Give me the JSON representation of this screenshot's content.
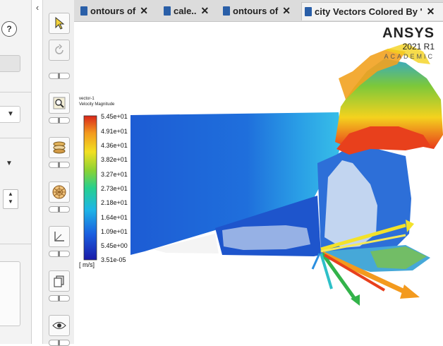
{
  "left_panel": {
    "collapse_glyph": "‹",
    "help_glyph": "?"
  },
  "toolbar": {
    "buttons": [
      "pointer-icon",
      "rotate-icon",
      "zoom-icon",
      "layers-icon",
      "mesh-sphere-icon",
      "axes-icon",
      "copy-icon",
      "eye-icon"
    ]
  },
  "tabs": [
    {
      "label": "ontours of",
      "active": false
    },
    {
      "label": "cale..",
      "active": false
    },
    {
      "label": "ontours of",
      "active": false
    },
    {
      "label": "city Vectors Colored By '",
      "active": true
    }
  ],
  "tab_close_glyph": "✕",
  "branding": {
    "name": "ANSYS",
    "version": "2021 R1",
    "edition": "ACADEMIC"
  },
  "legend": {
    "title_line1": "vector-1",
    "title_line2": "Velocity Magnitude",
    "ticks": [
      "5.45e+01",
      "4.91e+01",
      "4.36e+01",
      "3.82e+01",
      "3.27e+01",
      "2.73e+01",
      "2.18e+01",
      "1.64e+01",
      "1.09e+01",
      "5.45e+00",
      "3.51e-05"
    ],
    "units": "[ m/s]"
  },
  "colors": {
    "field_blue": "#1f5fd8",
    "field_light": "#35a8e8",
    "jet_red": "#e83a1a",
    "jet_yellow": "#f4d21e",
    "jet_green": "#33b34a",
    "vector_yellow": "#f3e22a"
  }
}
